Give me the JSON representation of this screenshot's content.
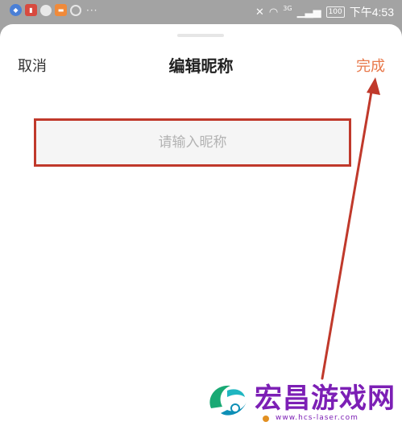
{
  "status_bar": {
    "time": "下午4:53",
    "battery": "100",
    "network": "3G",
    "more_indicator": "···"
  },
  "dialog": {
    "title": "编辑昵称",
    "cancel_label": "取消",
    "done_label": "完成",
    "nickname_input": {
      "value": "",
      "placeholder": "请输入昵称"
    }
  },
  "watermark": {
    "name": "宏昌游戏网",
    "url": "www.hcs-laser.com"
  },
  "colors": {
    "accent": "#e8784a",
    "highlight_box": "#c0392b",
    "annotation_arrow": "#c0392b"
  }
}
